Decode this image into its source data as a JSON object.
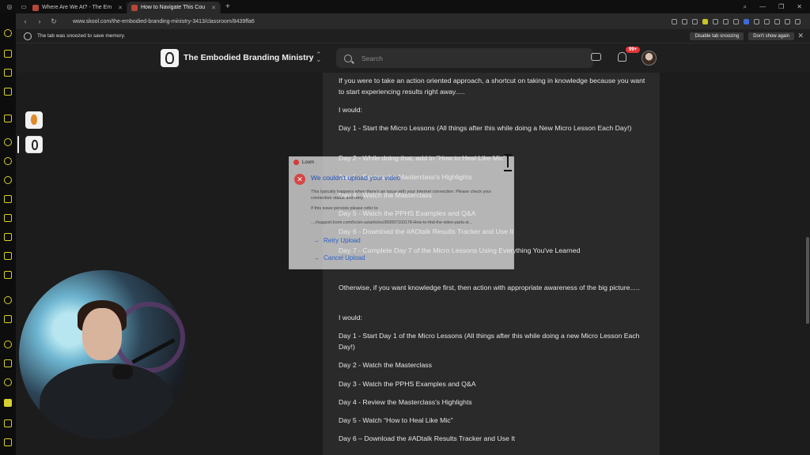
{
  "browser": {
    "tabs": [
      {
        "title": "Where Are We At? - The Em",
        "active": false
      },
      {
        "title": "How to Navigate This Cou",
        "active": true
      }
    ],
    "url": "www.skool.com/the-embodied-branding-ministry-3413/classroom/8439ffa6",
    "snooze": {
      "message": "The tab was snoozed to save memory.",
      "disable_label": "Disable tab snoozing",
      "dont_show_label": "Don't show again"
    }
  },
  "header": {
    "community_name": "The Embodied Branding Ministry",
    "search_placeholder": "Search",
    "notification_badge": "99+"
  },
  "content": {
    "paragraphs": [
      "If you were to take an action oriented approach, a shortcut on taking in knowledge because you want to start experiencing results right away.....",
      "I would:",
      "Day 1 - Start the Micro Lessons (All things after this while doing a New Micro Lesson Each Day!)",
      "Day 2 - While doing that, add in \"How to Heal Like Mic\"",
      "Day 3 - Review the Masterclass's Highlights",
      "Day 4 - Watch the Masterclass",
      "Day 5 - Watch the PPHS Examples and Q&A",
      "Day 6 - Download the #ADtalk Results Tracker and Use It",
      "Day 7 - Complete Day 7 of the Micro Lessons Using Everything You've Learned",
      "Otherwise, if you want knowledge first, then action with appropriate awareness of the big picture.....",
      "I would:",
      "Day 1 - Start Day 1 of the Micro Lessons (All things after this while doing a new Micro Lesson Each Day!)",
      "Day 2 - Watch the Masterclass",
      "Day 3 - Watch the PPHS Examples and Q&A",
      "Day 4 - Review the Masterclass's Highlights",
      "Day 5 - Watch “How to Heal Like Mic”",
      "Day 6 – Download the #ADtalk Results Tracker and Use It"
    ]
  },
  "loom_dialog": {
    "app_name": "Loom",
    "heading": "We couldn't upload your video",
    "body": "This typically happens when there's an issue with your internet connection. Please check your connection status and retry.",
    "persist_text": "If this issue persists please refer to",
    "link": "...://support.loom.com/hc/en-us/articles/360007103178-How-to-find-the-video-parts-st...",
    "retry_label": "Retry Upload",
    "cancel_label": "Cancel Upload"
  },
  "colors": {
    "accent": "#d6d12e",
    "badge": "#e2363a",
    "link_blue": "#2c5fc4"
  }
}
